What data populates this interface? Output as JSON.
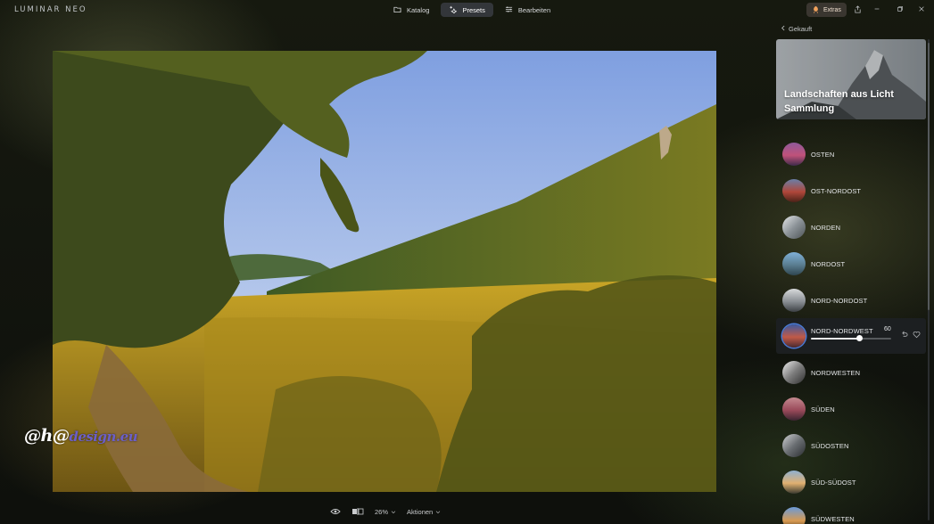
{
  "app": {
    "logo_text": "LUMINAR NEO"
  },
  "nav": {
    "tabs": [
      {
        "label": "Katalog",
        "icon": "folder-icon"
      },
      {
        "label": "Presets",
        "icon": "sparkle-icon",
        "active": true
      },
      {
        "label": "Bearbeiten",
        "icon": "sliders-icon"
      }
    ],
    "extras_label": "Extras"
  },
  "colors": {
    "accent_ring": "#4a7bd6",
    "active_tab_bg": "#33363a",
    "panel_active_bg": "#1c1f21"
  },
  "watermark": {
    "prefix": "@h@",
    "domain": "design.eu"
  },
  "bottom": {
    "zoom": "26%",
    "actions": "Aktionen"
  },
  "panel": {
    "back_label": "Gekauft",
    "collection_title": "Landschaften aus Licht",
    "collection_sub": "Sammlung",
    "presets": [
      {
        "label": "OSTEN"
      },
      {
        "label": "OST-NORDOST"
      },
      {
        "label": "NORDEN"
      },
      {
        "label": "NORDOST"
      },
      {
        "label": "NORD-NORDOST"
      },
      {
        "label": "NORD-NORDWEST",
        "active": true,
        "amount": "60",
        "amount_fraction": 0.6
      },
      {
        "label": "NORDWESTEN"
      },
      {
        "label": "SÜDEN"
      },
      {
        "label": "SÜDOSTEN"
      },
      {
        "label": "SÜD-SÜDOST"
      },
      {
        "label": "SÜDWESTEN"
      }
    ]
  }
}
